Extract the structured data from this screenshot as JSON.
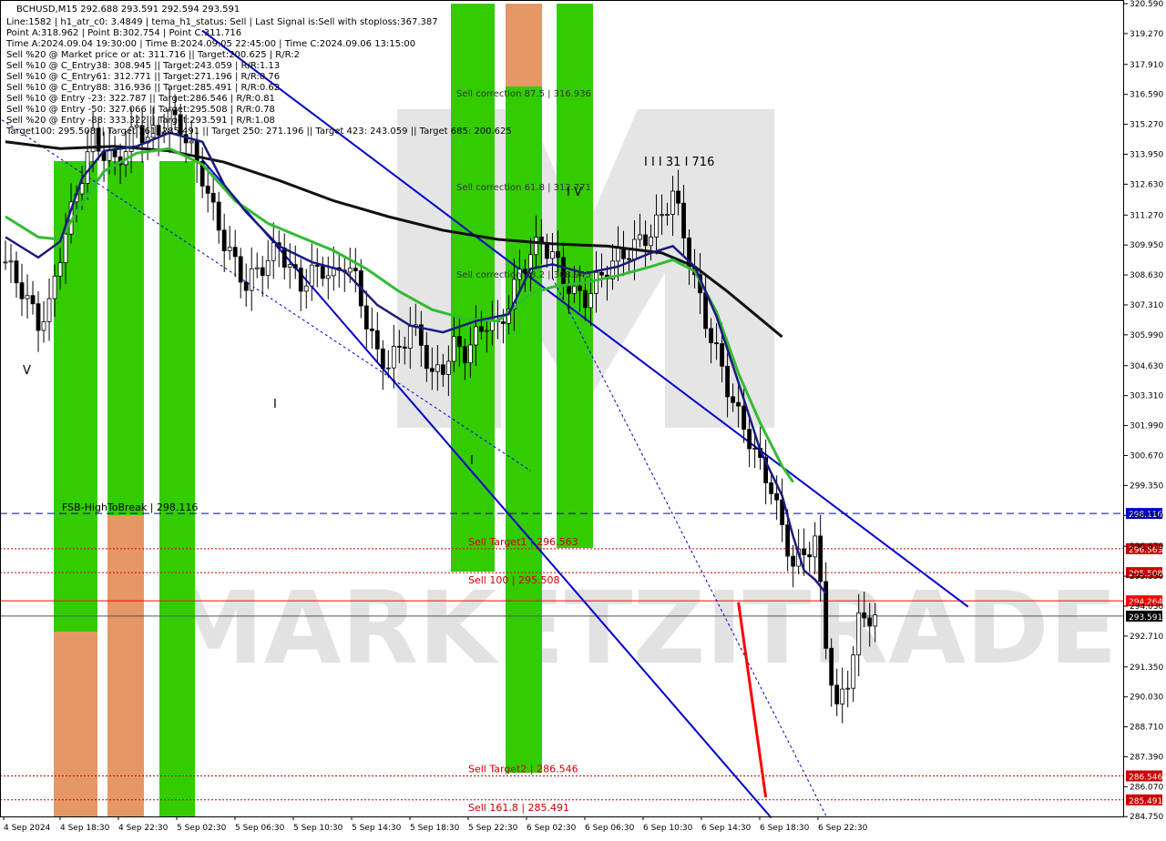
{
  "header": {
    "symbol_line": "BCHUSD,M15  292.688 293.591 292.594 293.591",
    "info_lines": [
      "Line:1582 | h1_atr_c0: 3.4849 | tema_h1_status: Sell | Last Signal is:Sell with stoploss:367.387",
      "Point A:318.962 | Point B:302.754 | Point C:311.716",
      "Time A:2024.09.04 19:30:00 | Time B:2024.09.05 22:45:00 | Time C:2024.09.06 13:15:00",
      "Sell %20 @ Market price or at: 311.716 || Target:200.625 | R/R:2",
      "Sell %10 @ C_Entry38: 308.945 || Target:243.059 | R/R:1.13",
      "Sell %10 @ C_Entry61: 312.771 || Target:271.196 | R/R:0.76",
      "Sell %10 @ C_Entry88: 316.936 || Target:285.491 | R/R:0.62",
      "Sell %10 @ Entry -23: 322.787 || Target:286.546 | R/R:0.81",
      "Sell %10 @ Entry -50: 327.066 || Target:295.508 | R/R:0.78",
      "Sell %20 @ Entry -88: 333.322 || Target:293.591 | R/R:1.08",
      "Target100: 295.508 || Target 161: 285.491 || Target 250: 271.196 || Target 423: 243.059 || Target 685: 200.625"
    ]
  },
  "watermark": "MARKETZITRADE",
  "wave_labels": {
    "v_left": "V",
    "i_left": "I",
    "i_mid": "I",
    "iii": "I I I 31 I 716",
    "iv": "I V"
  },
  "colors": {
    "background": "#ffffff",
    "green_zone": "#33cc00",
    "orange_zone": "#e59866",
    "channel": "#0000cc",
    "ma_slow": "#111111",
    "ma_mid": "#33bb33",
    "ma_fast": "#1a1a80",
    "bull_candle": "#000000",
    "level_red": "#cc0000",
    "fsb_blue": "#0000cc",
    "arrow_up": "#1a3cff",
    "arrow_down": "#ff0000"
  },
  "chart_data": {
    "type": "candlestick",
    "symbol": "BCHUSD",
    "timeframe": "M15",
    "ylim": [
      284.76,
      320.59
    ],
    "y_ticks": [
      "320.590",
      "319.270",
      "317.910",
      "316.590",
      "315.270",
      "313.950",
      "312.630",
      "311.270",
      "309.950",
      "308.630",
      "307.310",
      "305.990",
      "304.630",
      "303.310",
      "301.990",
      "300.670",
      "299.350",
      "298.030",
      "296.670",
      "295.350",
      "294.030",
      "292.710",
      "291.350",
      "290.030",
      "288.710",
      "287.390",
      "286.070",
      "284.750"
    ],
    "x_ticks": [
      "4 Sep 2024",
      "4 Sep 18:30",
      "4 Sep 22:30",
      "5 Sep 02:30",
      "5 Sep 06:30",
      "5 Sep 10:30",
      "5 Sep 14:30",
      "5 Sep 18:30",
      "5 Sep 22:30",
      "6 Sep 02:30",
      "6 Sep 06:30",
      "6 Sep 10:30",
      "6 Sep 14:30",
      "6 Sep 18:30",
      "6 Sep 22:30"
    ],
    "levels": [
      {
        "name": "FSB-HighToBreak",
        "value": 298.116,
        "label": "FSB-HighToBreak | 298.116",
        "tag": "298.116",
        "color": "#0000cc",
        "style": "dashed"
      },
      {
        "name": "Sell Target1",
        "value": 296.563,
        "label": "Sell Target1 | 296.563",
        "tag": "296.563",
        "color": "#cc0000",
        "style": "dotted"
      },
      {
        "name": "Sell 100",
        "value": 295.508,
        "label": "Sell 100 | 295.508",
        "tag": "295.508",
        "color": "#cc0000",
        "style": "dotted"
      },
      {
        "name": "Stop",
        "value": 294.264,
        "label": "",
        "tag": "294.264",
        "color": "#ff0000",
        "style": "solid"
      },
      {
        "name": "Price",
        "value": 293.591,
        "label": "",
        "tag": "293.591",
        "color": "#555555",
        "style": "solid"
      },
      {
        "name": "Sell Target2",
        "value": 286.546,
        "label": "Sell Target2 | 286.546",
        "tag": "286.546",
        "color": "#cc0000",
        "style": "dotted"
      },
      {
        "name": "Sell 161.8",
        "value": 285.491,
        "label": "Sell 161.8 | 285.491",
        "tag": "285.491",
        "color": "#cc0000",
        "style": "dotted"
      }
    ],
    "corrections": [
      {
        "label": "Sell correction 87.5 | 316.936",
        "value": 316.936
      },
      {
        "label": "Sell correction 61.8 | 312.771",
        "value": 312.771
      },
      {
        "label": "Sell correction 38.2 | 308.945",
        "value": 308.945
      }
    ],
    "close_path": [
      [
        0,
        309.2
      ],
      [
        3,
        308.0
      ],
      [
        6,
        306.5
      ],
      [
        8,
        307.2
      ],
      [
        10,
        309.6
      ],
      [
        12,
        311.4
      ],
      [
        14,
        313.1
      ],
      [
        16,
        314.7
      ],
      [
        18,
        314.0
      ],
      [
        20,
        313.6
      ],
      [
        22,
        314.2
      ],
      [
        24,
        315.2
      ],
      [
        26,
        314.6
      ],
      [
        28,
        315.0
      ],
      [
        30,
        315.6
      ],
      [
        32,
        315.2
      ],
      [
        34,
        314.1
      ],
      [
        36,
        313.0
      ],
      [
        38,
        311.4
      ],
      [
        40,
        310.1
      ],
      [
        42,
        309.1
      ],
      [
        44,
        308.2
      ],
      [
        46,
        308.8
      ],
      [
        48,
        309.3
      ],
      [
        50,
        309.9
      ],
      [
        52,
        308.9
      ],
      [
        54,
        308.2
      ],
      [
        56,
        308.7
      ],
      [
        58,
        308.9
      ],
      [
        60,
        308.5
      ],
      [
        62,
        309.2
      ],
      [
        64,
        308.4
      ],
      [
        66,
        306.6
      ],
      [
        68,
        305.1
      ],
      [
        70,
        304.7
      ],
      [
        72,
        305.4
      ],
      [
        74,
        306.3
      ],
      [
        76,
        305.7
      ],
      [
        78,
        304.1
      ],
      [
        80,
        304.6
      ],
      [
        82,
        305.5
      ],
      [
        84,
        305.2
      ],
      [
        86,
        305.9
      ],
      [
        88,
        306.6
      ],
      [
        90,
        306.2
      ],
      [
        92,
        307.4
      ],
      [
        94,
        308.7
      ],
      [
        96,
        309.6
      ],
      [
        98,
        310.1
      ],
      [
        100,
        309.5
      ],
      [
        102,
        308.5
      ],
      [
        104,
        307.8
      ],
      [
        106,
        307.6
      ],
      [
        108,
        308.3
      ],
      [
        110,
        308.9
      ],
      [
        112,
        309.4
      ],
      [
        114,
        309.7
      ],
      [
        116,
        310.1
      ],
      [
        118,
        310.5
      ],
      [
        120,
        311.2
      ],
      [
        122,
        312.3
      ],
      [
        124,
        310.4
      ],
      [
        126,
        308.4
      ],
      [
        128,
        306.6
      ],
      [
        130,
        305.2
      ],
      [
        132,
        303.7
      ],
      [
        134,
        302.4
      ],
      [
        136,
        301.4
      ],
      [
        138,
        300.2
      ],
      [
        140,
        299.3
      ],
      [
        142,
        297.4
      ],
      [
        144,
        295.9
      ],
      [
        146,
        296.3
      ],
      [
        148,
        297.0
      ],
      [
        150,
        292.4
      ],
      [
        152,
        289.4
      ],
      [
        154,
        290.8
      ],
      [
        156,
        293.3
      ],
      [
        158,
        293.6
      ],
      [
        159,
        293.59
      ]
    ],
    "ma_slow": [
      [
        0,
        314.5
      ],
      [
        10,
        314.2
      ],
      [
        20,
        314.3
      ],
      [
        30,
        314.1
      ],
      [
        40,
        313.6
      ],
      [
        50,
        312.8
      ],
      [
        60,
        311.9
      ],
      [
        70,
        311.2
      ],
      [
        80,
        310.6
      ],
      [
        90,
        310.2
      ],
      [
        100,
        310.0
      ],
      [
        110,
        309.9
      ],
      [
        120,
        309.6
      ],
      [
        126,
        309.0
      ],
      [
        132,
        307.9
      ],
      [
        138,
        306.7
      ],
      [
        142,
        305.9
      ]
    ],
    "ma_mid": [
      [
        0,
        311.2
      ],
      [
        6,
        310.3
      ],
      [
        10,
        310.2
      ],
      [
        14,
        311.8
      ],
      [
        18,
        313.2
      ],
      [
        24,
        314.0
      ],
      [
        30,
        314.2
      ],
      [
        36,
        313.5
      ],
      [
        42,
        311.9
      ],
      [
        48,
        310.9
      ],
      [
        54,
        310.3
      ],
      [
        60,
        309.7
      ],
      [
        66,
        308.9
      ],
      [
        72,
        307.9
      ],
      [
        78,
        307.1
      ],
      [
        84,
        306.7
      ],
      [
        90,
        306.6
      ],
      [
        96,
        307.8
      ],
      [
        100,
        308.1
      ],
      [
        106,
        308.3
      ],
      [
        112,
        308.6
      ],
      [
        118,
        309.0
      ],
      [
        122,
        309.3
      ],
      [
        126,
        308.8
      ],
      [
        130,
        307.0
      ],
      [
        134,
        304.3
      ],
      [
        138,
        302.1
      ],
      [
        142,
        300.2
      ],
      [
        144,
        299.5
      ]
    ],
    "ma_fast": [
      [
        0,
        310.3
      ],
      [
        6,
        309.4
      ],
      [
        10,
        310.1
      ],
      [
        14,
        312.9
      ],
      [
        18,
        314.1
      ],
      [
        24,
        314.3
      ],
      [
        30,
        314.9
      ],
      [
        36,
        314.5
      ],
      [
        40,
        312.6
      ],
      [
        44,
        311.4
      ],
      [
        50,
        309.9
      ],
      [
        56,
        309.2
      ],
      [
        62,
        308.8
      ],
      [
        68,
        307.3
      ],
      [
        74,
        306.4
      ],
      [
        80,
        306.1
      ],
      [
        86,
        306.6
      ],
      [
        92,
        306.9
      ],
      [
        96,
        308.9
      ],
      [
        100,
        309.1
      ],
      [
        106,
        308.7
      ],
      [
        112,
        309.0
      ],
      [
        118,
        309.6
      ],
      [
        122,
        309.9
      ],
      [
        126,
        309.0
      ],
      [
        130,
        306.8
      ],
      [
        134,
        303.9
      ],
      [
        138,
        300.9
      ],
      [
        142,
        298.9
      ],
      [
        144,
        297.1
      ],
      [
        146,
        295.6
      ],
      [
        148,
        295.2
      ],
      [
        150,
        294.6
      ]
    ],
    "channel_lines": [
      {
        "name": "upper",
        "points": [
          [
            36,
            319.4
          ],
          [
            176,
            294.0
          ]
        ]
      },
      {
        "name": "middle-lower",
        "points": [
          [
            36,
            313.7
          ],
          [
            140,
            284.7
          ]
        ]
      },
      {
        "name": "lower",
        "points": [
          [
            -4,
            316.0
          ],
          [
            96,
            300.0
          ]
        ]
      }
    ],
    "red_wave": [
      [
        134,
        294.2
      ],
      [
        139,
        285.6
      ]
    ],
    "x_count": 160
  }
}
